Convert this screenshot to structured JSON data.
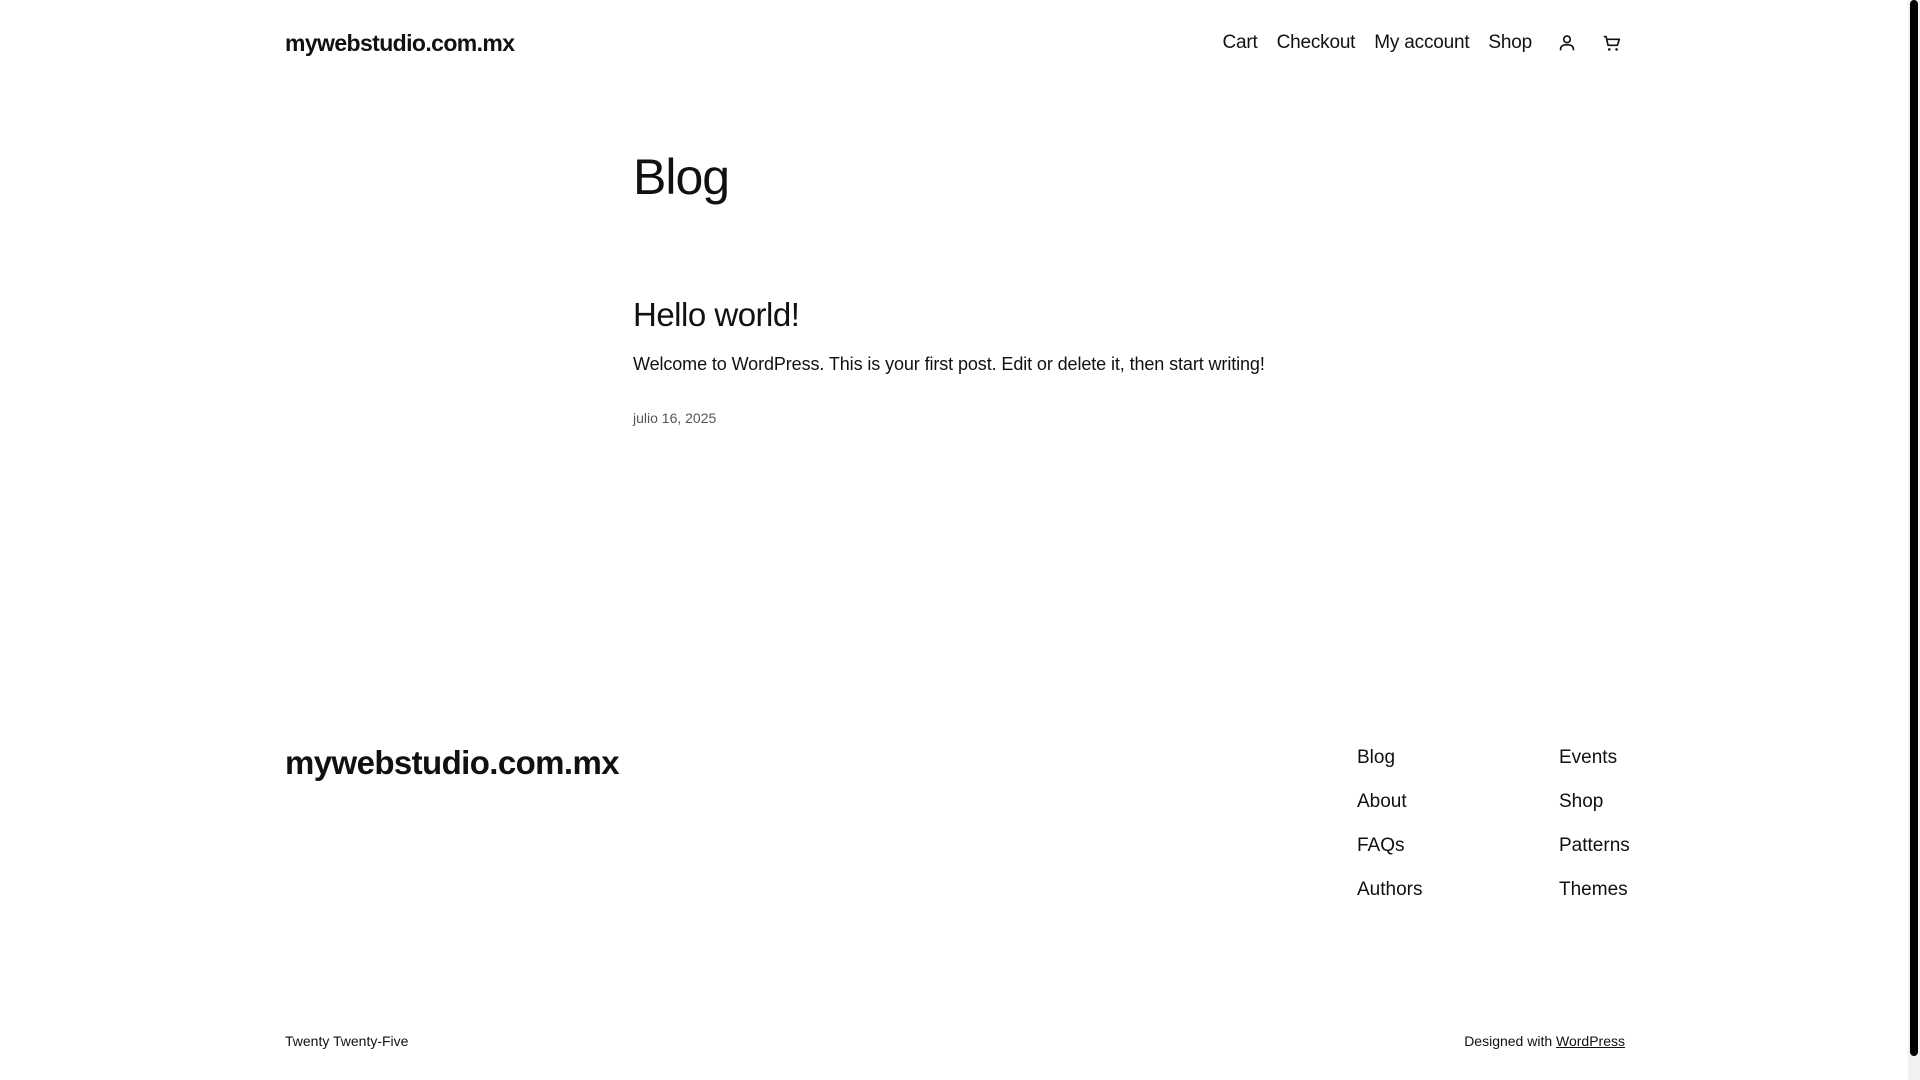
{
  "header": {
    "site_title": "mywebstudio.com.mx",
    "nav": [
      "Cart",
      "Checkout",
      "My account",
      "Shop"
    ],
    "icons": [
      "account-icon",
      "cart-icon"
    ]
  },
  "main": {
    "heading": "Blog",
    "post": {
      "title": "Hello world!",
      "excerpt": "Welcome to WordPress. This is your first post. Edit or delete it, then start writing!",
      "date": "julio 16, 2025"
    }
  },
  "footer": {
    "site_title": "mywebstudio.com.mx",
    "col1": [
      "Blog",
      "About",
      "FAQs",
      "Authors"
    ],
    "col2": [
      "Events",
      "Shop",
      "Patterns",
      "Themes"
    ],
    "theme_name": "Twenty Twenty-Five",
    "credit_prefix": "Designed with",
    "credit_link": "WordPress"
  }
}
